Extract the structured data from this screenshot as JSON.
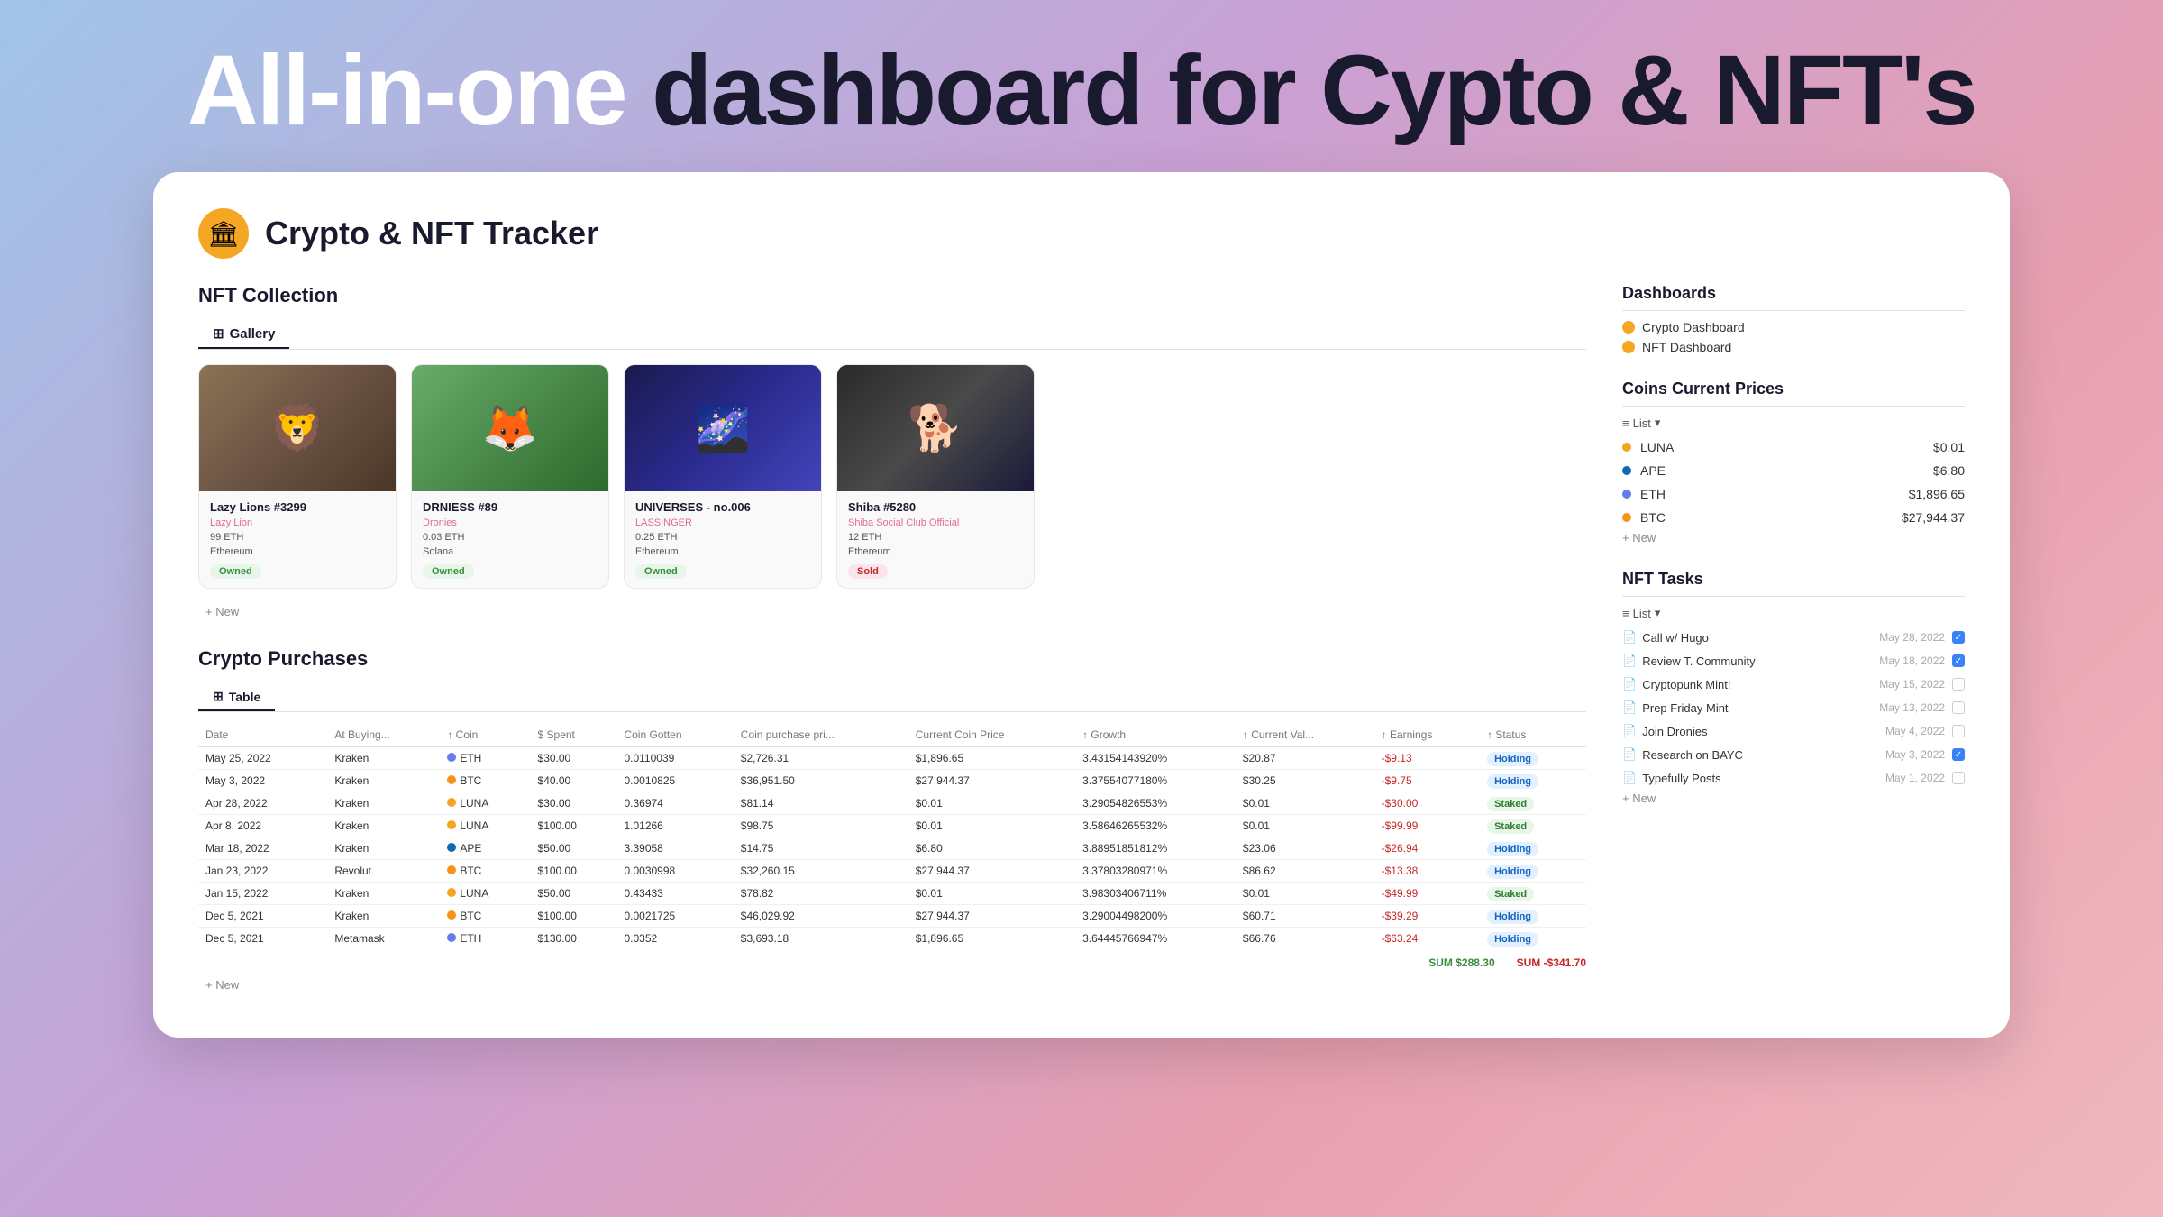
{
  "header": {
    "title_part1": "All-in-one",
    "title_part2": " dashboard for Cypto & NFT's"
  },
  "page": {
    "logo": "🏛",
    "title": "Crypto & NFT Tracker"
  },
  "nft_section": {
    "title": "NFT Collection",
    "tab_label": "Gallery",
    "add_new": "+ New",
    "cards": [
      {
        "name": "Lazy Lions #3299",
        "collection": "Lazy Lion",
        "price": "99 ETH",
        "blockchain": "Ethereum",
        "status": "Owned",
        "status_type": "owned",
        "emoji": "🦁"
      },
      {
        "name": "DRNIESS #89",
        "collection": "Dronies",
        "price": "0.03 ETH",
        "blockchain": "Solana",
        "status": "Owned",
        "status_type": "owned",
        "emoji": "🦊"
      },
      {
        "name": "UNIVERSES - no.006",
        "collection": "LASSINGER",
        "price": "0.25 ETH",
        "blockchain": "Ethereum",
        "status": "Owned",
        "status_type": "owned",
        "emoji": "🌌"
      },
      {
        "name": "Shiba #5280",
        "collection": "Shiba Social Club Official",
        "price": "12 ETH",
        "blockchain": "Ethereum",
        "status": "Sold",
        "status_type": "sold",
        "emoji": "🐕"
      }
    ]
  },
  "crypto_section": {
    "title": "Crypto Purchases",
    "tab_label": "Table",
    "columns": [
      "Date",
      "At Buying...",
      "Coin",
      "$ Spent",
      "Coin Gotten",
      "Coin purchase pri...",
      "Current Coin Price",
      "Growth",
      "Current Val...",
      "Earnings",
      "Status"
    ],
    "rows": [
      {
        "date": "May 25, 2022",
        "exchange": "Kraken",
        "coin": "ETH",
        "coin_color": "#627eea",
        "spent": "$30.00",
        "gotten": "0.0110039",
        "purchase_price": "$2,726.31",
        "current_price": "$1,896.65",
        "growth": "3.43154143920%",
        "current_val": "$20.87",
        "earnings": "-$9.13",
        "status": "Holding",
        "status_type": "holding"
      },
      {
        "date": "May 3, 2022",
        "exchange": "Kraken",
        "coin": "BTC",
        "coin_color": "#f7931a",
        "spent": "$40.00",
        "gotten": "0.0010825",
        "purchase_price": "$36,951.50",
        "current_price": "$27,944.37",
        "growth": "3.37554077180%",
        "current_val": "$30.25",
        "earnings": "-$9.75",
        "status": "Holding",
        "status_type": "holding"
      },
      {
        "date": "Apr 28, 2022",
        "exchange": "Kraken",
        "coin": "LUNA",
        "coin_color": "#f4a522",
        "spent": "$30.00",
        "gotten": "0.36974",
        "purchase_price": "$81.14",
        "current_price": "$0.01",
        "growth": "3.29054826553%",
        "current_val": "$0.01",
        "earnings": "-$30.00",
        "status": "Staked",
        "status_type": "staked"
      },
      {
        "date": "Apr 8, 2022",
        "exchange": "Kraken",
        "coin": "LUNA",
        "coin_color": "#f4a522",
        "spent": "$100.00",
        "gotten": "1.01266",
        "purchase_price": "$98.75",
        "current_price": "$0.01",
        "growth": "3.58646265532%",
        "current_val": "$0.01",
        "earnings": "-$99.99",
        "status": "Staked",
        "status_type": "staked"
      },
      {
        "date": "Mar 18, 2022",
        "exchange": "Kraken",
        "coin": "APE",
        "coin_color": "#1068b5",
        "spent": "$50.00",
        "gotten": "3.39058",
        "purchase_price": "$14.75",
        "current_price": "$6.80",
        "growth": "3.88951851812%",
        "current_val": "$23.06",
        "earnings": "-$26.94",
        "status": "Holding",
        "status_type": "holding"
      },
      {
        "date": "Jan 23, 2022",
        "exchange": "Revolut",
        "coin": "BTC",
        "coin_color": "#f7931a",
        "spent": "$100.00",
        "gotten": "0.0030998",
        "purchase_price": "$32,260.15",
        "current_price": "$27,944.37",
        "growth": "3.37803280971%",
        "current_val": "$86.62",
        "earnings": "-$13.38",
        "status": "Holding",
        "status_type": "holding"
      },
      {
        "date": "Jan 15, 2022",
        "exchange": "Kraken",
        "coin": "LUNA",
        "coin_color": "#f4a522",
        "spent": "$50.00",
        "gotten": "0.43433",
        "purchase_price": "$78.82",
        "current_price": "$0.01",
        "growth": "3.98303406711%",
        "current_val": "$0.01",
        "earnings": "-$49.99",
        "status": "Staked",
        "status_type": "staked"
      },
      {
        "date": "Dec 5, 2021",
        "exchange": "Kraken",
        "coin": "BTC",
        "coin_color": "#f7931a",
        "spent": "$100.00",
        "gotten": "0.0021725",
        "purchase_price": "$46,029.92",
        "current_price": "$27,944.37",
        "growth": "3.29004498200%",
        "current_val": "$60.71",
        "earnings": "-$39.29",
        "status": "Holding",
        "status_type": "holding"
      },
      {
        "date": "Dec 5, 2021",
        "exchange": "Metamask",
        "coin": "ETH",
        "coin_color": "#627eea",
        "spent": "$130.00",
        "gotten": "0.0352",
        "purchase_price": "$3,693.18",
        "current_price": "$1,896.65",
        "growth": "3.64445766947%",
        "current_val": "$66.76",
        "earnings": "-$63.24",
        "status": "Holding",
        "status_type": "holding"
      }
    ],
    "footer_sum": "SUM $288.30",
    "footer_sum_negative": "SUM -$341.70",
    "add_new": "+ New"
  },
  "dashboards": {
    "title": "Dashboards",
    "items": [
      {
        "label": "Crypto Dashboard",
        "color": "#f5a623"
      },
      {
        "label": "NFT Dashboard",
        "color": "#f5a623"
      }
    ]
  },
  "coins": {
    "title": "Coins Current Prices",
    "list_label": "List",
    "items": [
      {
        "name": "LUNA",
        "color": "#f4a522",
        "price": "$0.01"
      },
      {
        "name": "APE",
        "color": "#1068b5",
        "price": "$6.80"
      },
      {
        "name": "ETH",
        "color": "#627eea",
        "price": "$1,896.65"
      },
      {
        "name": "BTC",
        "color": "#f7931a",
        "price": "$27,944.37"
      }
    ],
    "add_new": "+ New"
  },
  "tasks": {
    "title": "NFT Tasks",
    "list_label": "List",
    "items": [
      {
        "label": "Call w/ Hugo",
        "date": "May 28, 2022",
        "checked": true
      },
      {
        "label": "Review T. Community",
        "date": "May 18, 2022",
        "checked": true
      },
      {
        "label": "Cryptopunk Mint!",
        "date": "May 15, 2022",
        "checked": false
      },
      {
        "label": "Prep Friday Mint",
        "date": "May 13, 2022",
        "checked": false
      },
      {
        "label": "Join Dronies",
        "date": "May 4, 2022",
        "checked": false
      },
      {
        "label": "Research on BAYC",
        "date": "May 3, 2022",
        "checked": true
      },
      {
        "label": "Typefully Posts",
        "date": "May 1, 2022",
        "checked": false
      }
    ],
    "add_new": "+ New"
  }
}
